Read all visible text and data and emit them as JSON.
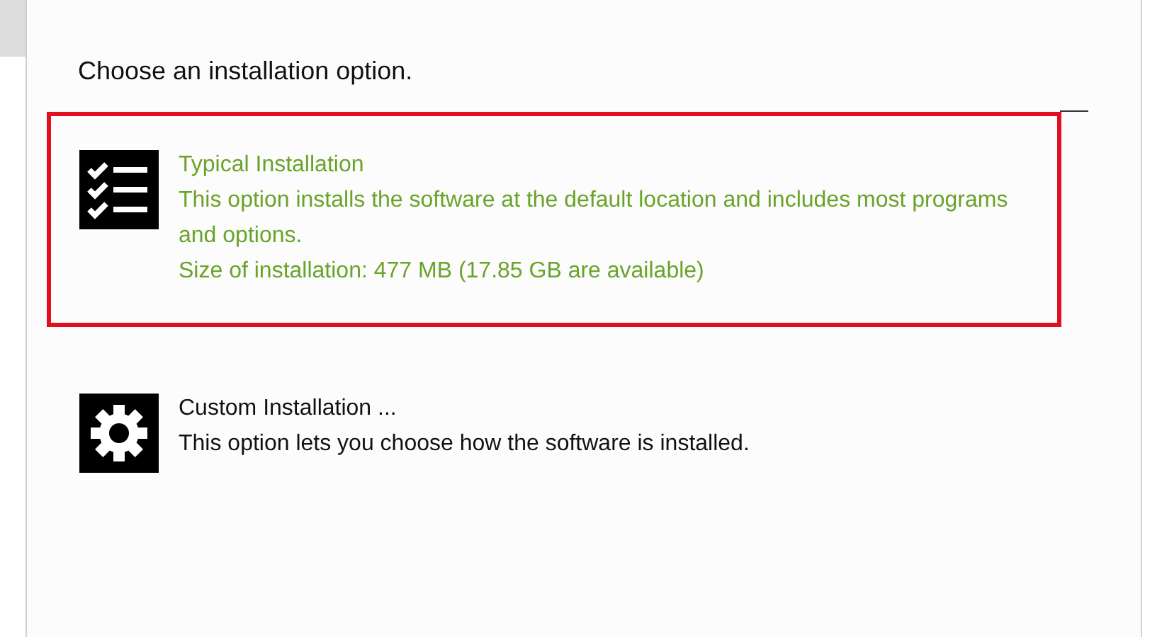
{
  "heading": "Choose an installation option.",
  "options": [
    {
      "kind": "checklist",
      "title": "Typical Installation",
      "lines": [
        "This option installs the software at the default location and includes most programs and options.",
        "Size of installation: 477 MB (17.85 GB are available)"
      ],
      "selected": true
    },
    {
      "kind": "gear",
      "title": "Custom Installation ...",
      "lines": [
        "This option lets you choose how the software is installed."
      ],
      "selected": false
    }
  ]
}
